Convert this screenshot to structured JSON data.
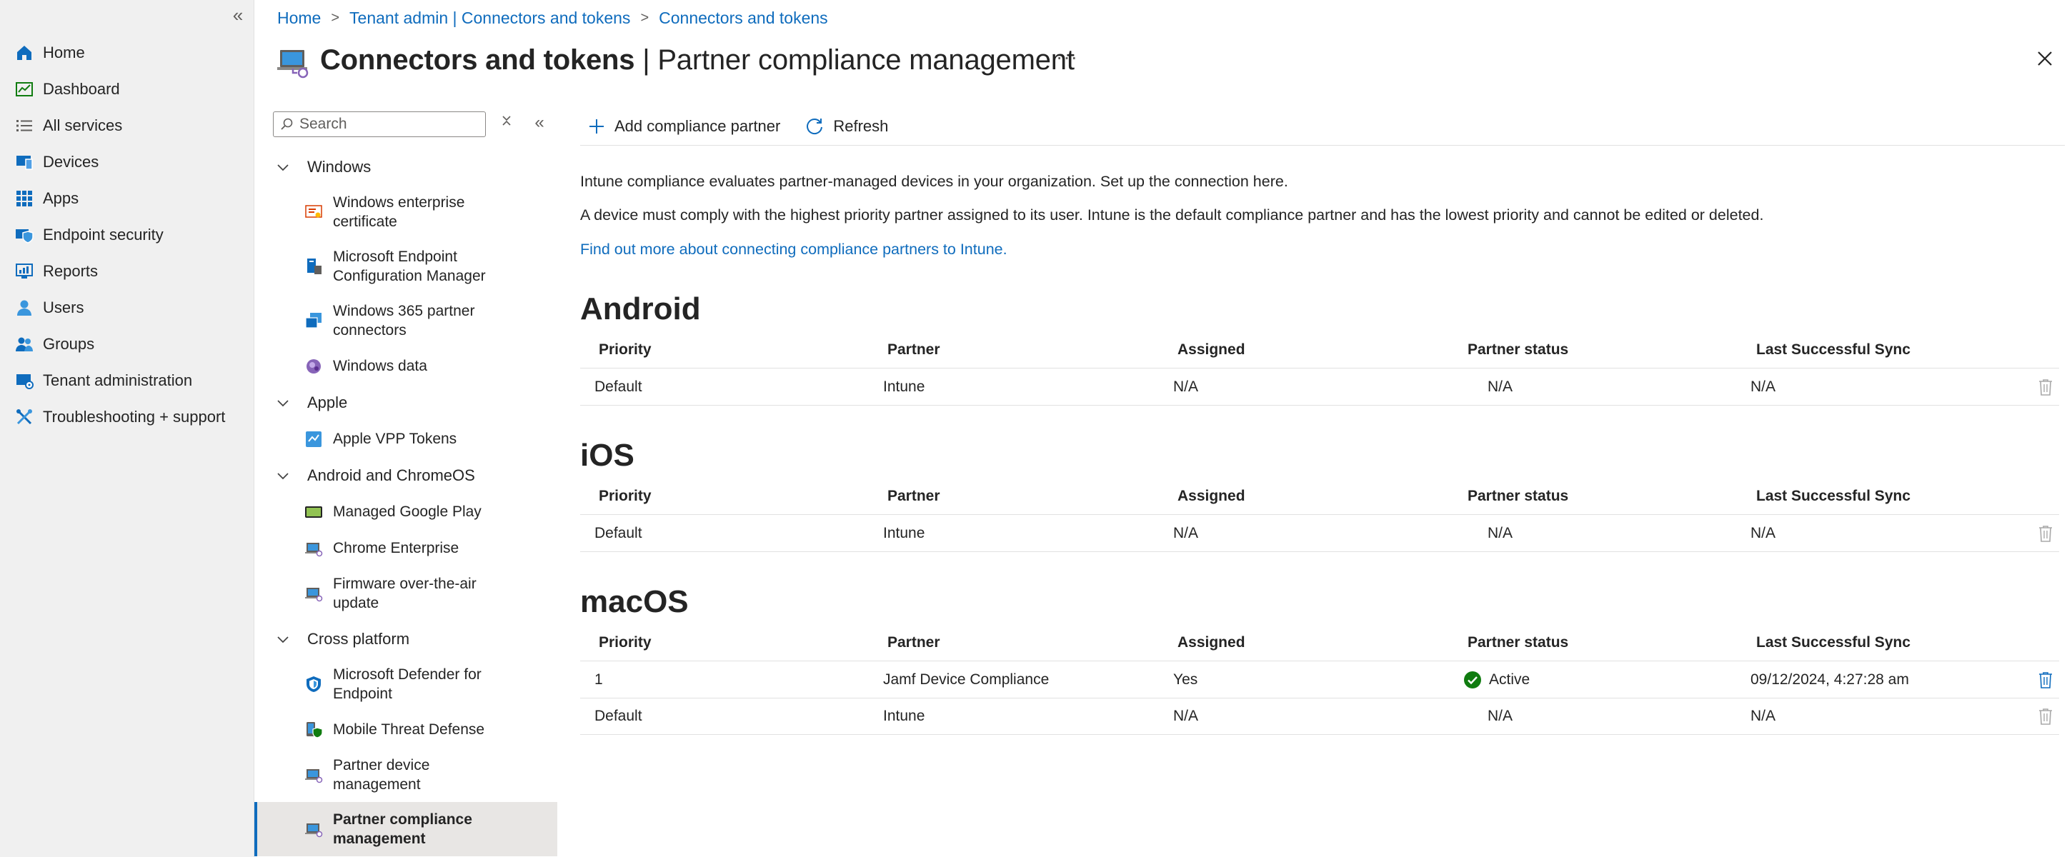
{
  "leftnav": {
    "items": [
      {
        "label": "Home",
        "icon": "home-icon"
      },
      {
        "label": "Dashboard",
        "icon": "dashboard-icon"
      },
      {
        "label": "All services",
        "icon": "list-icon"
      },
      {
        "label": "Devices",
        "icon": "devices-icon"
      },
      {
        "label": "Apps",
        "icon": "apps-icon"
      },
      {
        "label": "Endpoint security",
        "icon": "shield-icon"
      },
      {
        "label": "Reports",
        "icon": "reports-icon"
      },
      {
        "label": "Users",
        "icon": "user-icon"
      },
      {
        "label": "Groups",
        "icon": "groups-icon"
      },
      {
        "label": "Tenant administration",
        "icon": "tenant-icon"
      },
      {
        "label": "Troubleshooting + support",
        "icon": "wrench-icon"
      }
    ]
  },
  "breadcrumb": {
    "items": [
      "Home",
      "Tenant admin | Connectors and tokens",
      "Connectors and tokens"
    ]
  },
  "header": {
    "title": "Connectors and tokens",
    "subtitle": " | Partner compliance management",
    "more": "···"
  },
  "menu": {
    "search_placeholder": "Search",
    "groups": [
      {
        "label": "Windows",
        "items": [
          {
            "label": "Windows enterprise certificate"
          },
          {
            "label": "Microsoft Endpoint Configuration Manager"
          },
          {
            "label": "Windows 365 partner connectors"
          },
          {
            "label": "Windows data"
          }
        ]
      },
      {
        "label": "Apple",
        "items": [
          {
            "label": "Apple VPP Tokens"
          }
        ]
      },
      {
        "label": "Android and ChromeOS",
        "items": [
          {
            "label": "Managed Google Play"
          },
          {
            "label": "Chrome Enterprise"
          },
          {
            "label": "Firmware over-the-air update"
          }
        ]
      },
      {
        "label": "Cross platform",
        "items": [
          {
            "label": "Microsoft Defender for Endpoint"
          },
          {
            "label": "Mobile Threat Defense"
          },
          {
            "label": "Partner device management"
          },
          {
            "label": "Partner compliance management"
          }
        ]
      }
    ]
  },
  "toolbar": {
    "add_label": "Add compliance partner",
    "refresh_label": "Refresh"
  },
  "content": {
    "desc1": "Intune compliance evaluates partner-managed devices in your organization. Set up the connection here.",
    "desc2": "A device must comply with the highest priority partner assigned to its user. Intune is the default compliance partner and has the lowest priority and cannot be edited or deleted.",
    "link": "Find out more about connecting compliance partners to Intune."
  },
  "columns": [
    "Priority",
    "Partner",
    "Assigned",
    "Partner status",
    "Last Successful Sync"
  ],
  "sections": [
    {
      "title": "Android",
      "rows": [
        {
          "priority": "Default",
          "partner": "Intune",
          "assigned": "N/A",
          "status": "N/A",
          "sync": "N/A"
        }
      ]
    },
    {
      "title": "iOS",
      "rows": [
        {
          "priority": "Default",
          "partner": "Intune",
          "assigned": "N/A",
          "status": "N/A",
          "sync": "N/A"
        }
      ]
    },
    {
      "title": "macOS",
      "rows": [
        {
          "priority": "1",
          "partner": "Jamf Device Compliance",
          "assigned": "Yes",
          "status": "Active",
          "sync": "09/12/2024, 4:27:28 am"
        },
        {
          "priority": "Default",
          "partner": "Intune",
          "assigned": "N/A",
          "status": "N/A",
          "sync": "N/A"
        }
      ]
    }
  ],
  "colors": {
    "accent": "#0f6cbd",
    "success": "#107c10",
    "nav_bg": "#f0f0f0"
  }
}
